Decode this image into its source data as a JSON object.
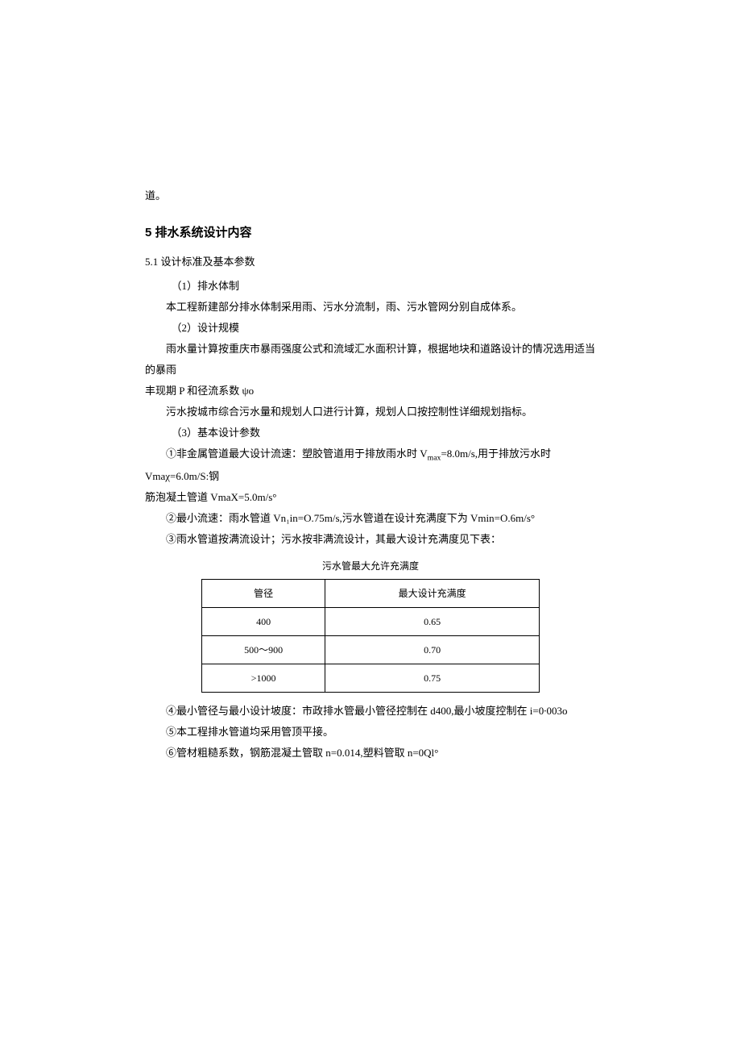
{
  "frag_top": "道。",
  "h5": "5 排水系统设计内容",
  "h51": "5.1 设计标准及基本参数",
  "item1_label": "（1）排水体制",
  "item1_body": "本工程新建部分排水体制采用雨、污水分流制，雨、污水管网分别自成体系。",
  "item2_label": "（2）设计规模",
  "item2_body_a": "雨水量计算按重庆市暴雨强度公式和流域汇水面积计算，根据地块和道路设计的情况选用适当的暴雨",
  "item2_body_b": "丰现期 P 和径流系数 ψo",
  "item2_body_c": "污水按城市综合污水量和规划人口进行计算，规划人口按控制性详细规划指标。",
  "item3_label": "（3）基本设计参数",
  "item3_line1a": "①非金属管道最大设计流速：塑胶管道用于排放雨水时 V",
  "item3_line1a_sub": "max",
  "item3_line1a_tail": "=8.0m/s,用于排放污水时 Vmaχ=6.0m/S:钢",
  "item3_line1b": "筋泡凝土管道 VmaX=5.0m/s°",
  "item3_line2": "②最小流速：雨水管道 Vn₁in=O.75m/s,污水管道在设计充满度下为 Vmin=O.6m/s°",
  "item3_line3": "③雨水管道按满流设计；污水按非满流设计，其最大设计充满度见下表：",
  "table_title": "污水管最大允许充满度",
  "table": {
    "headers": [
      "管径",
      "最大设计充满度"
    ],
    "rows": [
      [
        "400",
        "0.65"
      ],
      [
        "500〜900",
        "0.70"
      ],
      [
        ">1000",
        "0.75"
      ]
    ]
  },
  "item3_line4": "④最小管径与最小设计坡度：市政排水管最小管径控制在 d400,最小坡度控制在 i=0∙003o",
  "item3_line5": "⑤本工程排水管道均采用管顶平接。",
  "item3_line6": "⑥管材粗糙系数，钢筋混凝土管取 n=0.014,塑料管取 n=0Ql°"
}
